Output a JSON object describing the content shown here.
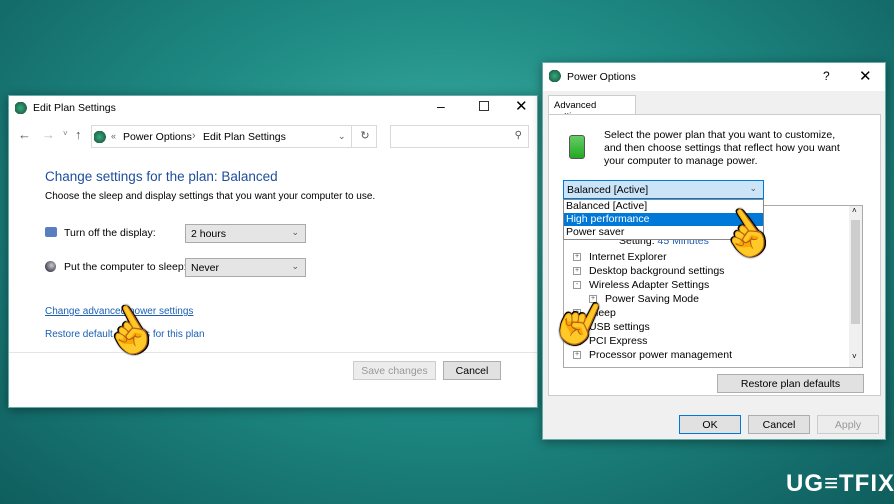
{
  "edit_plan": {
    "title": "Edit Plan Settings",
    "breadcrumb": {
      "sep1": "«",
      "item1": "Power Options",
      "sep2": "›",
      "item2": "Edit Plan Settings"
    },
    "search_placeholder": "",
    "heading": "Change settings for the plan: Balanced",
    "description": "Choose the sleep and display settings that you want your computer to use.",
    "display_label": "Turn off the display:",
    "display_value": "2 hours",
    "sleep_label": "Put the computer to sleep:",
    "sleep_value": "Never",
    "advanced_link": "Change advanced power settings",
    "restore_link": "Restore default settings for this plan",
    "save_button": "Save changes",
    "cancel_button": "Cancel"
  },
  "power_options": {
    "title": "Power Options",
    "help": "?",
    "tab": "Advanced settings",
    "intro": "Select the power plan that you want to customize, and then choose settings that reflect how you want your computer to manage power.",
    "plan_selected": "Balanced [Active]",
    "plan_options": [
      "Balanced [Active]",
      "High performance",
      "Power saver"
    ],
    "setting_label": "Setting:",
    "setting_value": "45 Minutes",
    "tree": [
      {
        "label": "Internet Explorer",
        "state": "+"
      },
      {
        "label": "Desktop background settings",
        "state": "+"
      },
      {
        "label": "Wireless Adapter Settings",
        "state": "-"
      },
      {
        "label": "Power Saving Mode",
        "state": "+",
        "child": true
      },
      {
        "label": "Sleep",
        "state": "+"
      },
      {
        "label": "USB settings",
        "state": "+"
      },
      {
        "label": "PCI Express",
        "state": "+"
      },
      {
        "label": "Processor power management",
        "state": "+"
      }
    ],
    "restore_button": "Restore plan defaults",
    "ok_button": "OK",
    "cancel_button": "Cancel",
    "apply_button": "Apply"
  },
  "watermark": "UG≡TFIX",
  "colors": {
    "link": "#1a5fb4",
    "highlight": "#0078d7",
    "heading": "#1e4e9c"
  }
}
